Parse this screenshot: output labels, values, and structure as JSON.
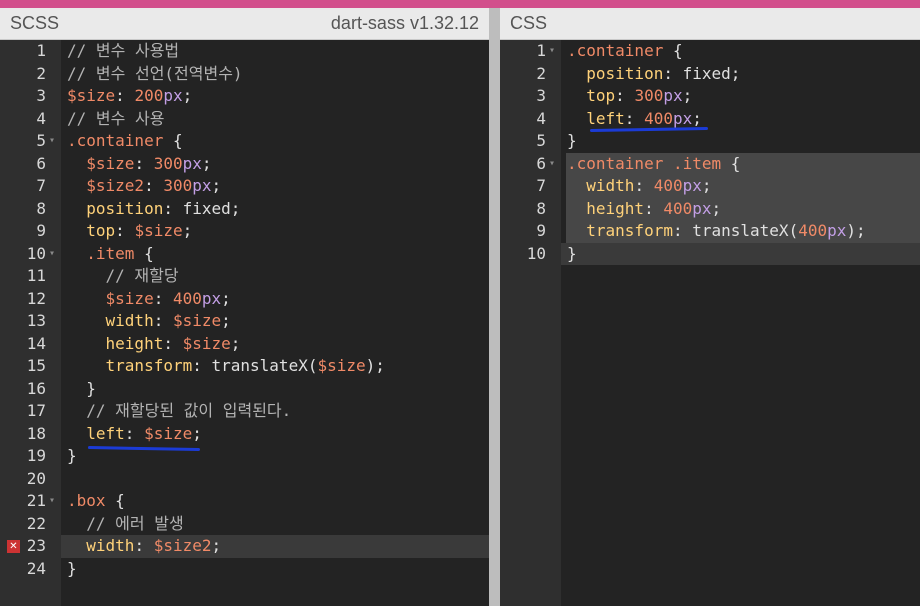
{
  "app": {
    "scss_panel_title": "SCSS",
    "compiler_version": "dart-sass v1.32.12",
    "css_panel_title": "CSS"
  },
  "scss_lines": [
    {
      "n": "1",
      "t": "// 변수 사용법"
    },
    {
      "n": "2",
      "t": "// 변수 선언(전역변수)"
    },
    {
      "n": "3",
      "t": "$size: 200px;"
    },
    {
      "n": "4",
      "t": "// 변수 사용"
    },
    {
      "n": "5",
      "t": ".container {"
    },
    {
      "n": "6",
      "t": "  $size: 300px;"
    },
    {
      "n": "7",
      "t": "  $size2: 300px;"
    },
    {
      "n": "8",
      "t": "  position: fixed;"
    },
    {
      "n": "9",
      "t": "  top: $size;"
    },
    {
      "n": "10",
      "t": "  .item {"
    },
    {
      "n": "11",
      "t": "    // 재할당"
    },
    {
      "n": "12",
      "t": "    $size: 400px;"
    },
    {
      "n": "13",
      "t": "    width: $size;"
    },
    {
      "n": "14",
      "t": "    height: $size;"
    },
    {
      "n": "15",
      "t": "    transform: translateX($size);"
    },
    {
      "n": "16",
      "t": "  }"
    },
    {
      "n": "17",
      "t": "  // 재할당된 값이 입력된다."
    },
    {
      "n": "18",
      "t": "  left: $size;"
    },
    {
      "n": "19",
      "t": "}"
    },
    {
      "n": "20",
      "t": ""
    },
    {
      "n": "21",
      "t": ".box {"
    },
    {
      "n": "22",
      "t": "  // 에러 발생"
    },
    {
      "n": "23",
      "t": "  width: $size2;"
    },
    {
      "n": "24",
      "t": "}"
    }
  ],
  "css_lines": [
    {
      "n": "1",
      "t": ".container {"
    },
    {
      "n": "2",
      "t": "  position: fixed;"
    },
    {
      "n": "3",
      "t": "  top: 300px;"
    },
    {
      "n": "4",
      "t": "  left: 400px;"
    },
    {
      "n": "5",
      "t": "}"
    },
    {
      "n": "6",
      "t": ".container .item {"
    },
    {
      "n": "7",
      "t": "  width: 400px;"
    },
    {
      "n": "8",
      "t": "  height: 400px;"
    },
    {
      "n": "9",
      "t": "  transform: translateX(400px);"
    },
    {
      "n": "10",
      "t": "}"
    }
  ],
  "error_line": "23",
  "colors": {
    "accent_strip": "#d24f8c",
    "error": "#cc3333",
    "annotation": "#1b3bd6"
  }
}
